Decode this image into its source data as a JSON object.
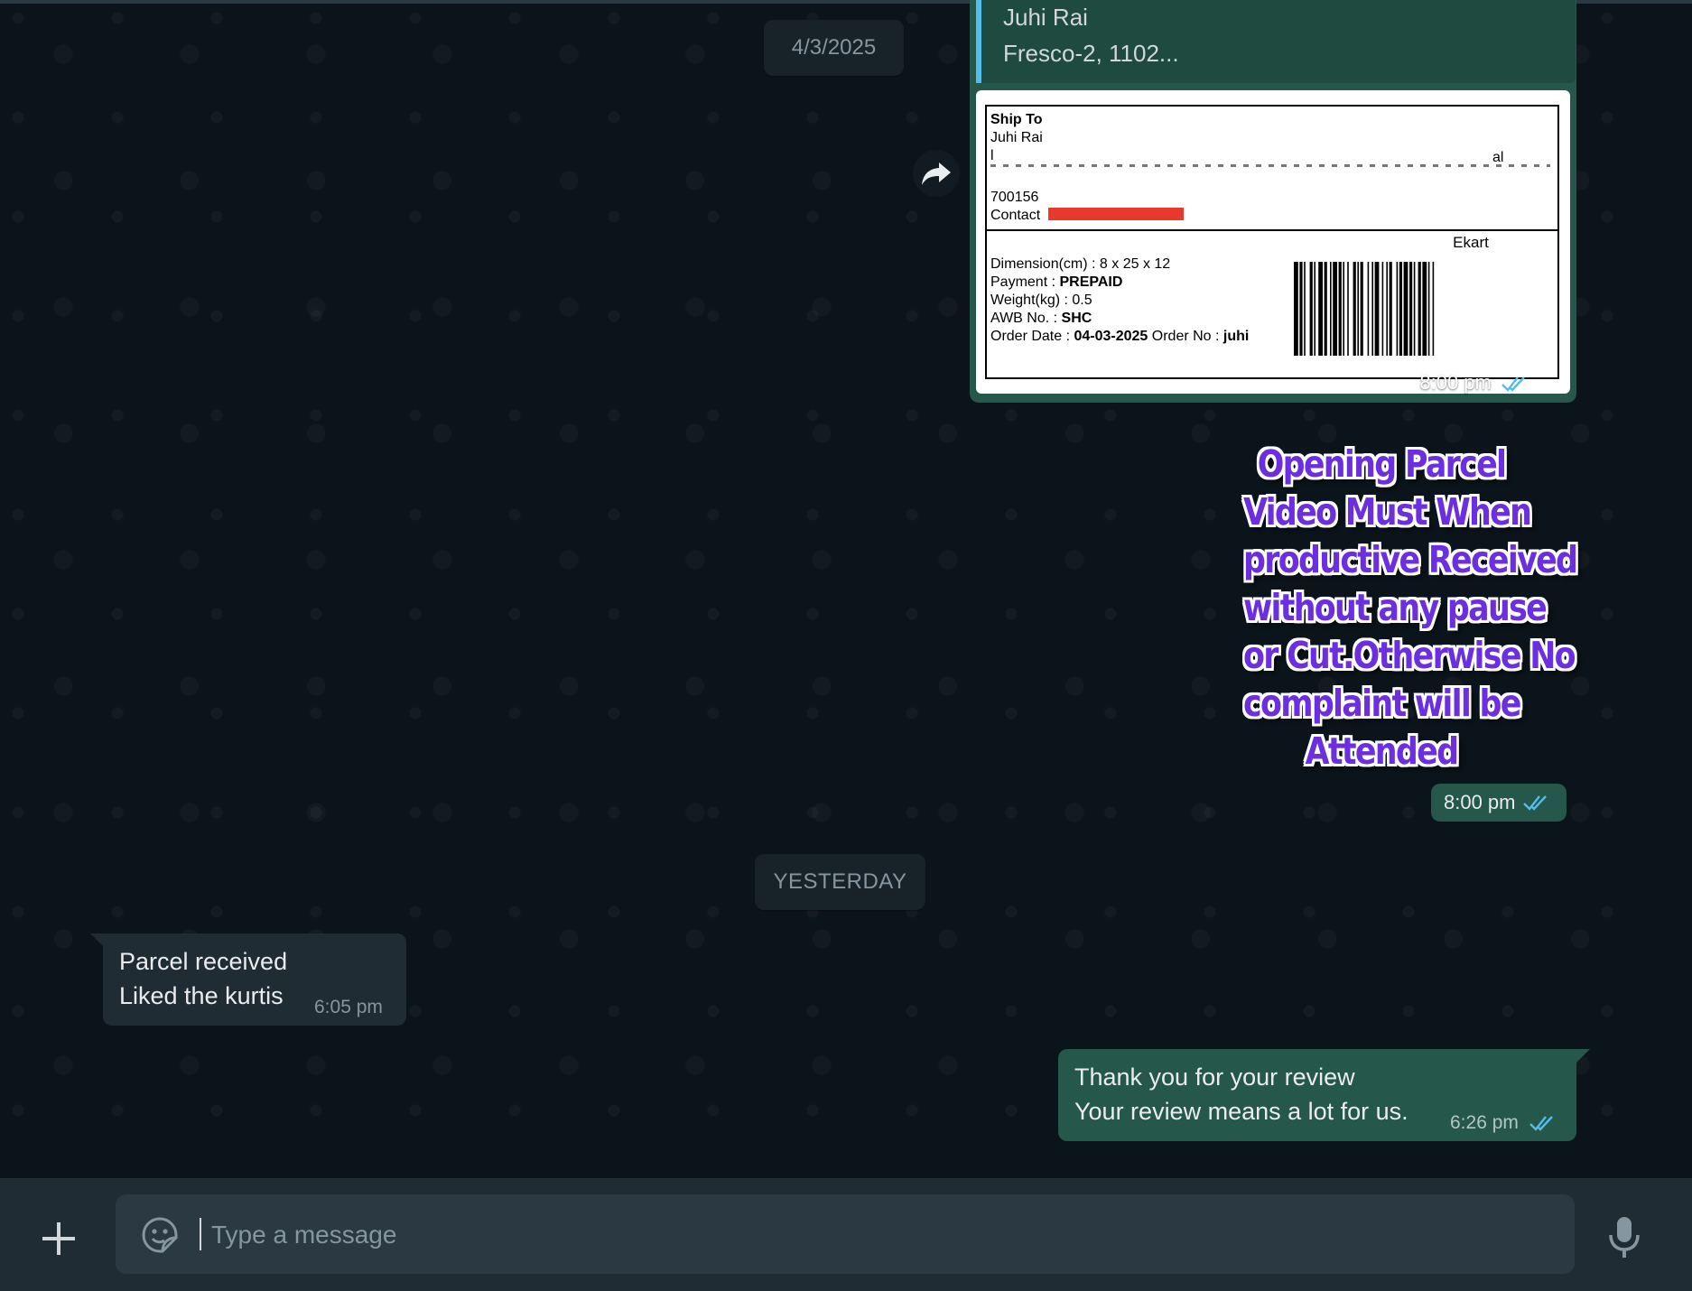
{
  "chat": {
    "date_1": "4/3/2025",
    "date_2": "YESTERDAY",
    "shipping_message": {
      "quote_name": "Juhi Rai",
      "quote_text": "Fresco-2,  1102...",
      "label": {
        "ship_to": "Ship To",
        "name": "Juhi Rai",
        "addr_partial_1": "l",
        "addr_partial_2": "al",
        "pincode": "700156",
        "contact_label": "Contact",
        "courier": "Ekart",
        "dimension": "Dimension(cm) : 8 x 25 x 12",
        "payment_label": "Payment : ",
        "payment_value": "PREPAID",
        "weight": "Weight(kg) : 0.5",
        "awb_label": "AWB No. : ",
        "awb_value": "SHC",
        "order_date_label": "Order Date : ",
        "order_date_value": "04-03-2025",
        "order_no_label": " Order No : ",
        "order_no_value": "juhi"
      },
      "time": "8:00 pm",
      "status": "read"
    },
    "sticker": {
      "lines": [
        "Opening Parcel",
        "Video Must When",
        "productive Received",
        "without any pause",
        "or Cut.Otherwise No",
        "complaint will be",
        "Attended"
      ],
      "color": "#6b2fe0",
      "time": "8:00 pm",
      "status": "read"
    },
    "incoming_message": {
      "line_1": "Parcel received",
      "line_2": "Liked the kurtis",
      "time": "6:05 pm"
    },
    "outgoing_message": {
      "line_1": "Thank you for your review",
      "line_2": "Your review means a lot for us.",
      "time": "6:26 pm",
      "status": "read"
    }
  },
  "composer": {
    "placeholder": "Type a message",
    "value": ""
  },
  "colors": {
    "background": "#0b141a",
    "outgoing_bubble": "#25574a",
    "incoming_bubble": "#202c33",
    "read_ticks": "#53bdeb",
    "footer": "#202c33"
  },
  "icons": [
    "forward-icon",
    "plus-icon",
    "sticker-icon",
    "mic-icon",
    "double-check-icon"
  ]
}
